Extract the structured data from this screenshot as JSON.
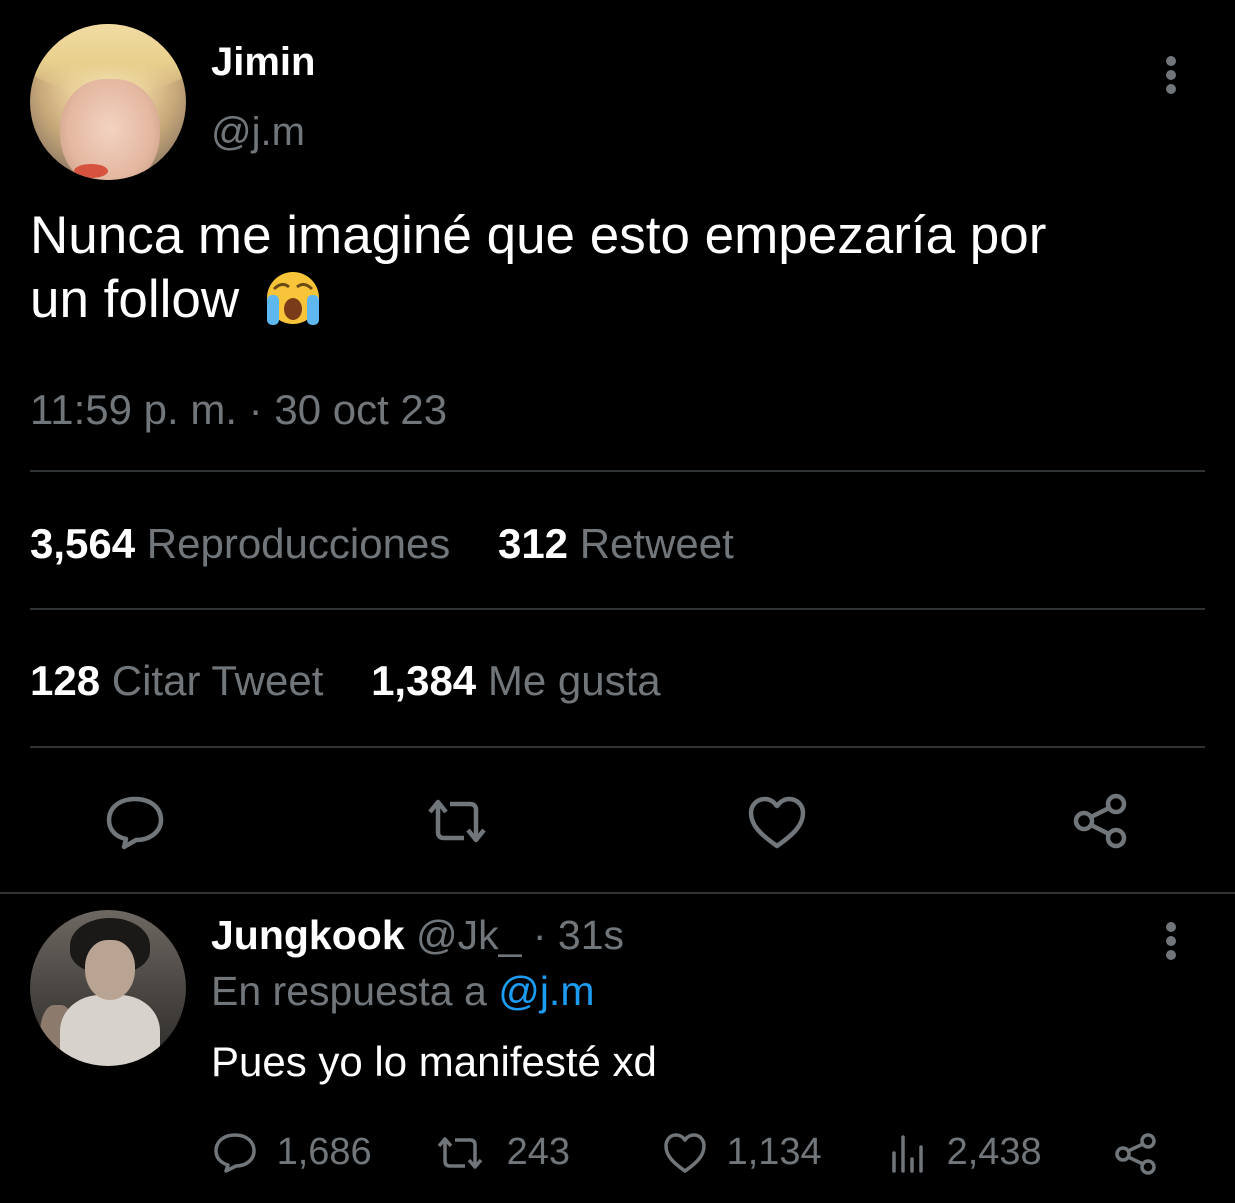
{
  "tweet": {
    "author_name": "Jimin",
    "author_handle": "@j.m",
    "text_line1": "Nunca me imaginé que esto empezaría por",
    "text_line2": "un follow",
    "emoji": "😭",
    "timestamp": "11:59 p. m. · 30 oct 23",
    "stats": {
      "views_count": "3,564",
      "views_label": "Reproducciones",
      "retweets_count": "312",
      "retweets_label": "Retweet",
      "quotes_count": "128",
      "quotes_label": "Citar Tweet",
      "likes_count": "1,384",
      "likes_label": "Me gusta"
    },
    "actions": [
      "reply-icon",
      "retweet-icon",
      "like-icon",
      "share-icon"
    ]
  },
  "reply": {
    "author_name": "Jungkook",
    "author_handle": "@Jk_",
    "time": "· 31s",
    "replying_prefix": "En respuesta a",
    "replying_to": "@j.m",
    "text": "Pues yo lo manifesté xd",
    "replies_count": "1,686",
    "retweets_count": "243",
    "likes_count": "1,134",
    "views_count": "2,438"
  },
  "colors": {
    "background": "#000000",
    "text": "#ffffff",
    "muted": "#71767b",
    "divider": "#2f3336",
    "link": "#1d9bf0"
  }
}
